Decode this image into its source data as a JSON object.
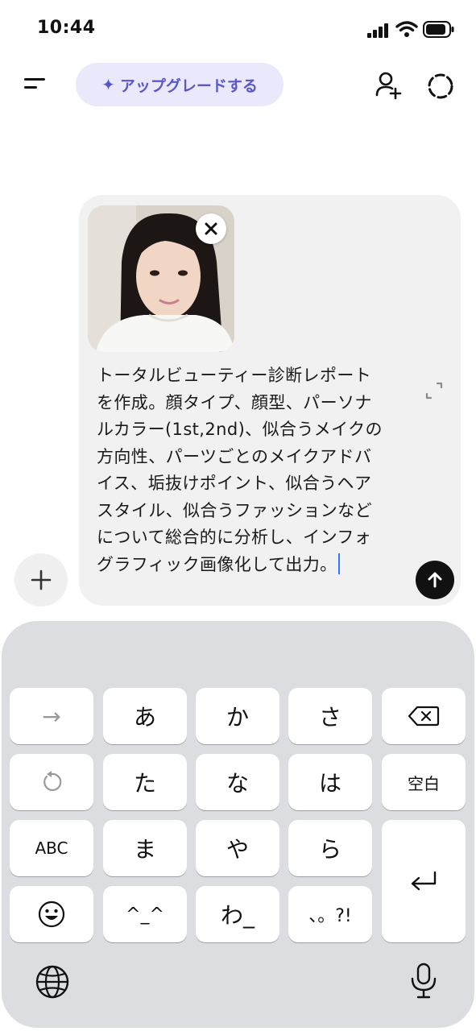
{
  "status_bar": {
    "time": "10:44"
  },
  "header": {
    "upgrade_label": "アップグレードする",
    "icons": [
      "menu-icon",
      "add-person-icon",
      "temporary-chat-icon"
    ]
  },
  "composer": {
    "attachment": {
      "type": "image",
      "description_icon": "photo-thumbnail"
    },
    "text": "トータルビューティー診断レポートを作成。顔タイプ、顔型、パーソナルカラー(1st,2nd)、似合うメイクの方向性、パーツごとのメイクアドバイス、垢抜けポイント、似合うヘアスタイル、似合うファッションなどについて総合的に分析し、インフォグラフィック画像化して出力。",
    "colors": {
      "accent": "#5a56c9",
      "send_button": "#111111",
      "caret": "#2f7cf6"
    }
  },
  "keyboard": {
    "row1": [
      "→",
      "あ",
      "か",
      "さ",
      "delete"
    ],
    "row2": [
      "undo",
      "た",
      "な",
      "は",
      "空白"
    ],
    "row3": [
      "ABC",
      "ま",
      "や",
      "ら",
      "return"
    ],
    "row4": [
      "emoji",
      "^_^",
      "わ_",
      "、。?!"
    ],
    "labels": {
      "arrow": "→",
      "a": "あ",
      "ka": "か",
      "sa": "さ",
      "ta": "た",
      "na": "な",
      "ha": "は",
      "space": "空白",
      "abc": "ABC",
      "ma": "ま",
      "ya": "や",
      "ra": "ら",
      "kaomoji": "^_^",
      "wa": "わ_",
      "punct": "、。?!"
    }
  }
}
